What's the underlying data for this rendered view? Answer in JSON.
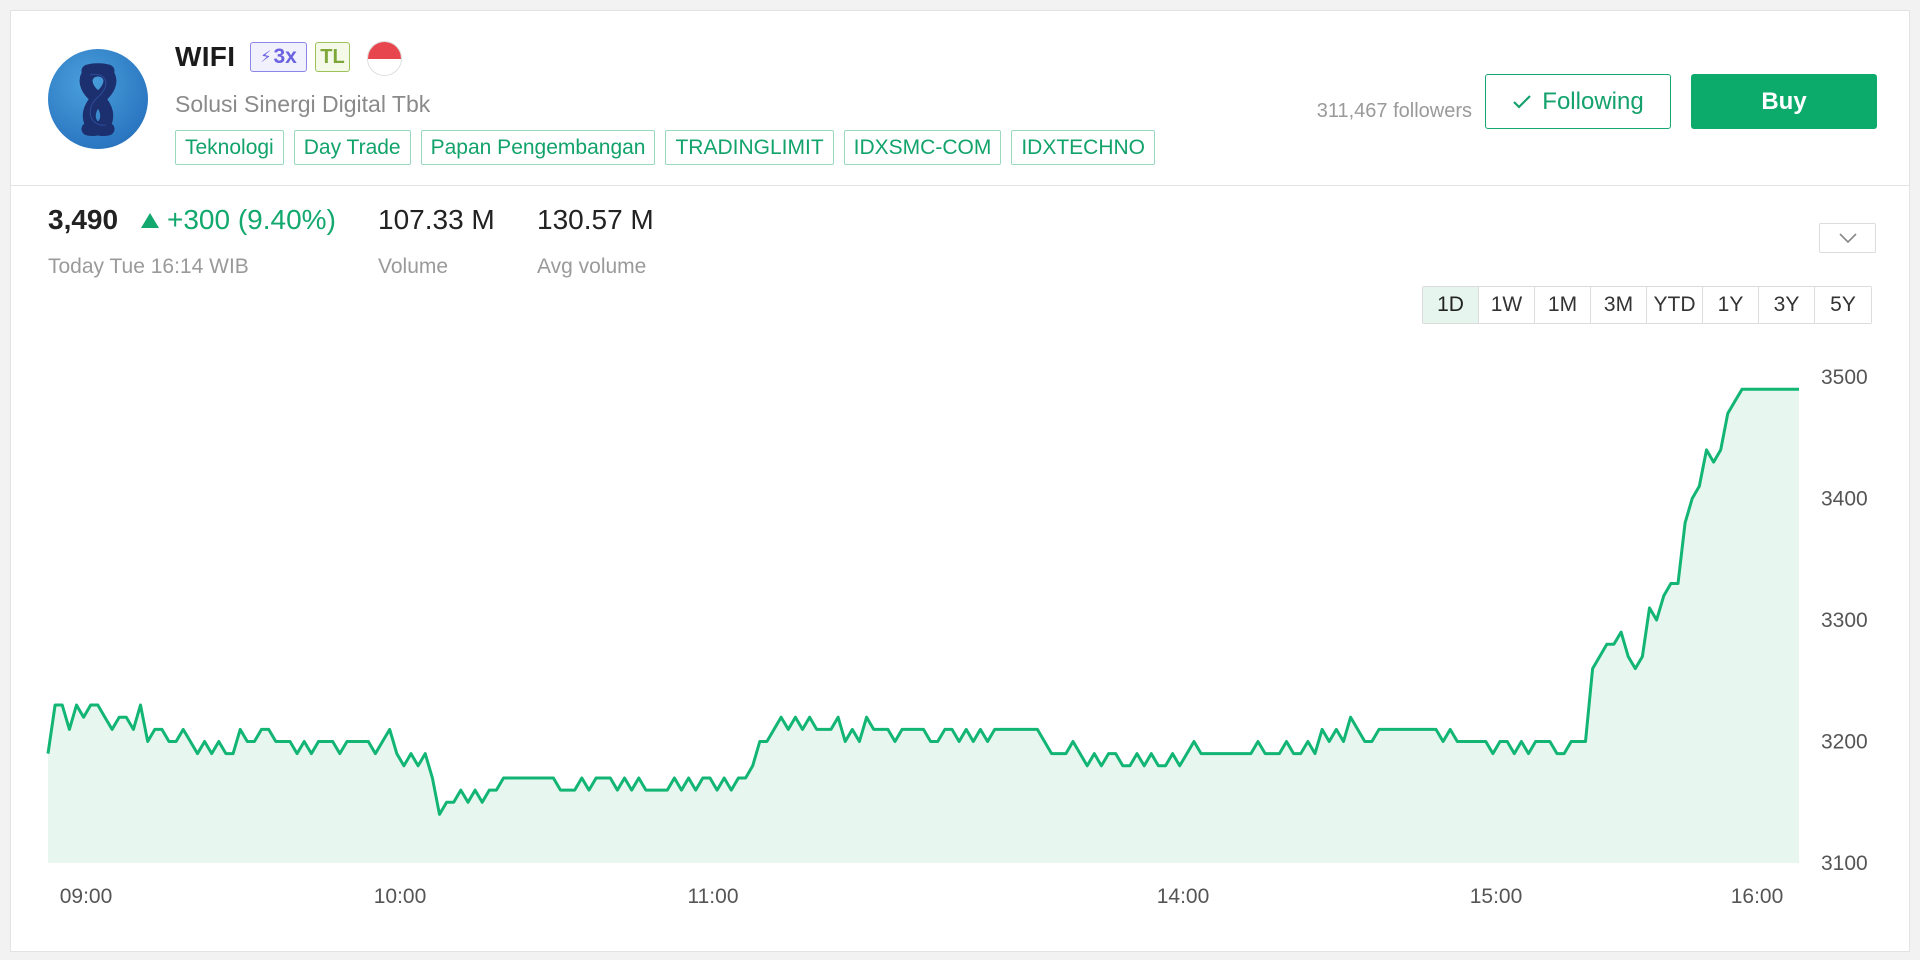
{
  "header": {
    "ticker": "WIFI",
    "badge_leverage": "3x",
    "badge_tl": "TL",
    "company_name": "Solusi Sinergi Digital Tbk",
    "tags": [
      "Teknologi",
      "Day Trade",
      "Papan Pengembangan",
      "TRADINGLIMIT",
      "IDXSMC-COM",
      "IDXTECHNO"
    ],
    "followers": "311,467 followers",
    "following_label": "Following",
    "buy_label": "Buy"
  },
  "stats": {
    "price": "3,490",
    "change": "+300 (9.40%)",
    "timestamp": "Today Tue 16:14 WIB",
    "volume": "107.33 M",
    "volume_label": "Volume",
    "avg_volume": "130.57 M",
    "avg_volume_label": "Avg volume"
  },
  "ranges": [
    "1D",
    "1W",
    "1M",
    "3M",
    "YTD",
    "1Y",
    "3Y",
    "5Y"
  ],
  "active_range": "1D",
  "colors": {
    "accent": "#13a86e",
    "buy": "#0dab6b",
    "line": "#12b574",
    "fill": "#e7f7ef"
  },
  "chart_data": {
    "type": "area",
    "ylim": [
      3100,
      3500
    ],
    "y_ticks": [
      3500,
      3400,
      3300,
      3200,
      3100
    ],
    "x_tick_labels": [
      "09:00",
      "10:00",
      "11:00",
      "14:00",
      "15:00",
      "16:00"
    ],
    "series": [
      {
        "values": [
          3190,
          3230,
          3230,
          3210,
          3230,
          3220,
          3230,
          3230,
          3220,
          3210,
          3220,
          3220,
          3210,
          3230,
          3200,
          3210,
          3210,
          3200,
          3200,
          3210,
          3200,
          3190,
          3200,
          3190,
          3200,
          3190,
          3190,
          3210,
          3200,
          3200,
          3210,
          3210,
          3200,
          3200,
          3200,
          3190,
          3200,
          3190,
          3200,
          3200,
          3200,
          3190,
          3200,
          3200,
          3200,
          3200,
          3190,
          3200,
          3210,
          3190,
          3180,
          3190,
          3180,
          3190,
          3170,
          3140,
          3150,
          3150,
          3160,
          3150,
          3160,
          3150,
          3160,
          3160,
          3170,
          3170,
          3170,
          3170,
          3170,
          3170,
          3170,
          3170,
          3160,
          3160,
          3160,
          3170,
          3160,
          3170,
          3170,
          3170,
          3160,
          3170,
          3160,
          3170,
          3160,
          3160,
          3160,
          3160,
          3170,
          3160,
          3170,
          3160,
          3170,
          3170,
          3160,
          3170,
          3160,
          3170,
          3170,
          3180,
          3200,
          3200,
          3210,
          3220,
          3210,
          3220,
          3210,
          3220,
          3210,
          3210,
          3210,
          3220,
          3200,
          3210,
          3200,
          3220,
          3210,
          3210,
          3210,
          3200,
          3210,
          3210,
          3210,
          3210,
          3200,
          3200,
          3210,
          3210,
          3200,
          3210,
          3200,
          3210,
          3200,
          3210,
          3210,
          3210,
          3210,
          3210,
          3210,
          3210,
          3200,
          3190,
          3190,
          3190,
          3200,
          3190,
          3180,
          3190,
          3180,
          3190,
          3190,
          3180,
          3180,
          3190,
          3180,
          3190,
          3180,
          3180,
          3190,
          3180,
          3190,
          3200,
          3190,
          3190,
          3190,
          3190,
          3190,
          3190,
          3190,
          3190,
          3200,
          3190,
          3190,
          3190,
          3200,
          3190,
          3190,
          3200,
          3190,
          3210,
          3200,
          3210,
          3200,
          3220,
          3210,
          3200,
          3200,
          3210,
          3210,
          3210,
          3210,
          3210,
          3210,
          3210,
          3210,
          3210,
          3200,
          3210,
          3200,
          3200,
          3200,
          3200,
          3200,
          3190,
          3200,
          3200,
          3190,
          3200,
          3190,
          3200,
          3200,
          3200,
          3190,
          3190,
          3200,
          3200,
          3200,
          3260,
          3270,
          3280,
          3280,
          3290,
          3270,
          3260,
          3270,
          3310,
          3300,
          3320,
          3330,
          3330,
          3380,
          3400,
          3410,
          3440,
          3430,
          3440,
          3470,
          3480,
          3490,
          3490,
          3490,
          3490,
          3490,
          3490,
          3490,
          3490,
          3490
        ]
      }
    ]
  }
}
